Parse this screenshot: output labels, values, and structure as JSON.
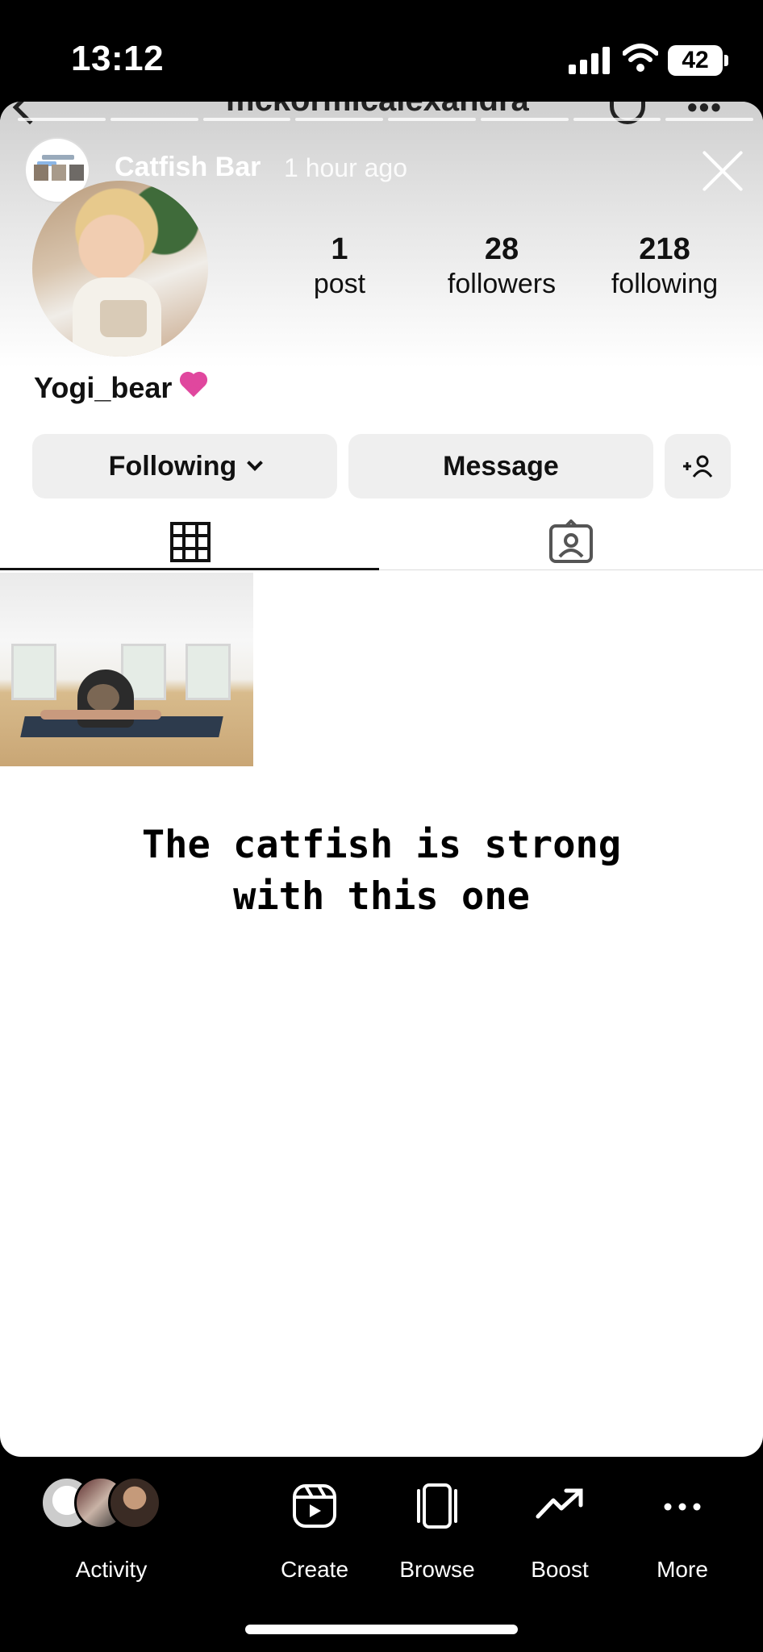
{
  "status_bar": {
    "time": "13:12",
    "battery": "42"
  },
  "peek": {
    "username": "mckormicalexandra"
  },
  "story": {
    "author": "Catfish Bar",
    "time_ago": "1 hour ago"
  },
  "profile": {
    "stats": [
      {
        "number": "1",
        "label": "post"
      },
      {
        "number": "28",
        "label": "followers"
      },
      {
        "number": "218",
        "label": "following"
      }
    ],
    "display_name": "Yogi_bear",
    "following_button": "Following",
    "message_button": "Message"
  },
  "overlay_text": "The catfish is strong\nwith this one",
  "bottom_bar": {
    "items": [
      {
        "label": "Activity",
        "icon": "activity-avatars"
      },
      {
        "label": "Create",
        "icon": "reels-icon"
      },
      {
        "label": "Browse",
        "icon": "browse-icon"
      },
      {
        "label": "Boost",
        "icon": "trending-up-icon"
      },
      {
        "label": "More",
        "icon": "more-icon"
      }
    ]
  }
}
